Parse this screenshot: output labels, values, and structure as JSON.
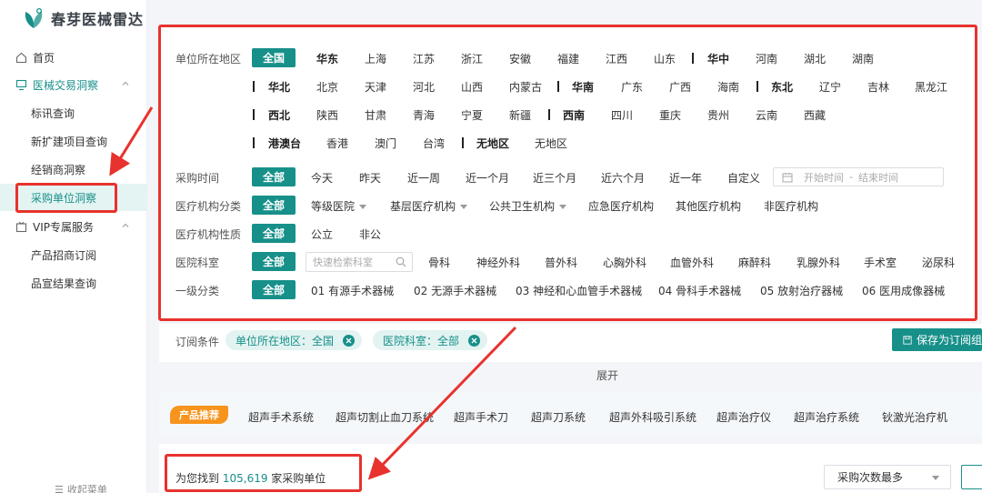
{
  "app": {
    "title": "春芽医械雷达"
  },
  "sidebar": {
    "home": "首页",
    "group1": "医械交易洞察",
    "group1_items": [
      "标讯查询",
      "新扩建项目查询",
      "经销商洞察",
      "采购单位洞察"
    ],
    "group2": "VIP专属服务",
    "group2_items": [
      "产品招商订阅",
      "品宣结果查询"
    ],
    "collapse": "收起菜单"
  },
  "filters": {
    "region": {
      "label": "单位所在地区",
      "all": "全国",
      "row1": {
        "head": "华东",
        "items": [
          "上海",
          "江苏",
          "浙江",
          "安徽",
          "福建",
          "江西",
          "山东"
        ]
      },
      "row1b": {
        "head": "华中",
        "items": [
          "河南",
          "湖北",
          "湖南"
        ]
      },
      "row2": {
        "head": "华北",
        "items": [
          "北京",
          "天津",
          "河北",
          "山西",
          "内蒙古"
        ]
      },
      "row2b": {
        "head": "华南",
        "items": [
          "广东",
          "广西",
          "海南"
        ]
      },
      "row2c": {
        "head": "东北",
        "items": [
          "辽宁",
          "吉林",
          "黑龙江"
        ]
      },
      "row3": {
        "head": "西北",
        "items": [
          "陕西",
          "甘肃",
          "青海",
          "宁夏",
          "新疆"
        ]
      },
      "row3b": {
        "head": "西南",
        "items": [
          "四川",
          "重庆",
          "贵州",
          "云南",
          "西藏"
        ]
      },
      "row4": {
        "head": "港澳台",
        "items": [
          "香港",
          "澳门",
          "台湾"
        ]
      },
      "row4b": {
        "head": "无地区",
        "items": [
          "无地区"
        ]
      }
    },
    "time": {
      "label": "采购时间",
      "all": "全部",
      "items": [
        "今天",
        "昨天",
        "近一周",
        "近一个月",
        "近三个月",
        "近六个月",
        "近一年",
        "自定义"
      ],
      "start_placeholder": "开始时间",
      "end_placeholder": "结束时间",
      "dash": "-"
    },
    "org_type": {
      "label": "医疗机构分类",
      "all": "全部",
      "items": [
        "等级医院",
        "基层医疗机构",
        "公共卫生机构",
        "应急医疗机构",
        "其他医疗机构",
        "非医疗机构"
      ]
    },
    "org_nature": {
      "label": "医疗机构性质",
      "all": "全部",
      "items": [
        "公立",
        "非公"
      ]
    },
    "dept": {
      "label": "医院科室",
      "all": "全部",
      "search_placeholder": "快速检索科室",
      "items": [
        "骨科",
        "神经外科",
        "普外科",
        "心胸外科",
        "血管外科",
        "麻醉科",
        "乳腺外科",
        "手术室",
        "泌尿科"
      ]
    },
    "category": {
      "label": "一级分类",
      "all": "全部",
      "items": [
        "01 有源手术器械",
        "02 无源手术器械",
        "03 神经和心血管手术器械",
        "04 骨科手术器械",
        "05 放射治疗器械",
        "06 医用成像器械"
      ]
    }
  },
  "subscription": {
    "label": "订阅条件",
    "tags": [
      "单位所在地区：全国",
      "医院科室：全部"
    ],
    "save_label": "保存为订阅组"
  },
  "expand_label": "展开",
  "recommend": {
    "badge": "产品推荐",
    "items": [
      "超声手术系统",
      "超声切割止血刀系统",
      "超声手术刀",
      "超声刀系统",
      "超声外科吸引系统",
      "超声治疗仪",
      "超声治疗系统",
      "钬激光治疗机"
    ]
  },
  "result": {
    "prefix": "为您找到",
    "count": "105,619",
    "suffix": "家采购单位",
    "sort_label": "采购次数最多"
  },
  "colors": {
    "accent": "#17908a",
    "annotation": "#e8322e",
    "badge": "#f7941d"
  }
}
